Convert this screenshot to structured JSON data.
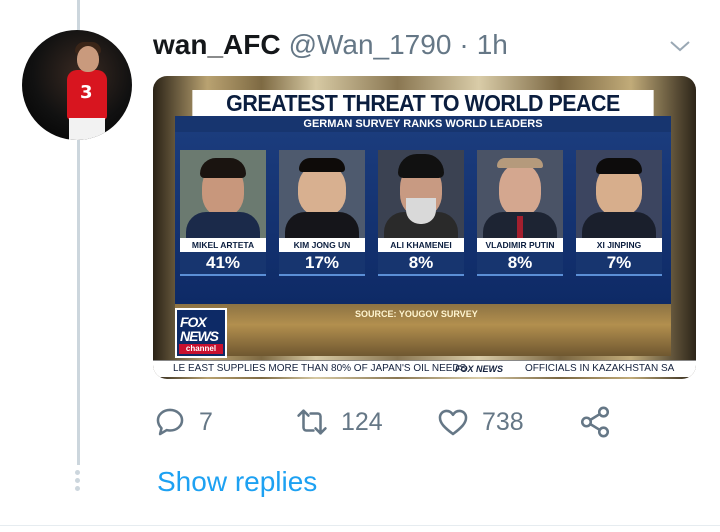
{
  "tweet": {
    "display_name": "wan_AFC",
    "handle": "@Wan_1790",
    "time_separator": "·",
    "time": "1h",
    "avatar_number": "3"
  },
  "media": {
    "headline": "GREATEST THREAT TO WORLD PEACE",
    "subheadline": "GERMAN SURVEY RANKS WORLD LEADERS",
    "leaders": [
      {
        "name": "MIKEL ARTETA",
        "pct": "41%"
      },
      {
        "name": "KIM JONG UN",
        "pct": "17%"
      },
      {
        "name": "ALI KHAMENEI",
        "pct": "8%"
      },
      {
        "name": "VLADIMIR PUTIN",
        "pct": "8%"
      },
      {
        "name": "XI JINPING",
        "pct": "7%"
      }
    ],
    "source": "SOURCE: YOUGOV SURVEY",
    "logo": {
      "line1": "FOX",
      "line2": "NEWS",
      "line3": "channel"
    },
    "ticker_left": "LE EAST SUPPLIES MORE THAN 80% OF JAPAN'S OIL NEEDS",
    "ticker_logo": "FOX NEWS",
    "ticker_right": "OFFICIALS IN KAZAKHSTAN SA"
  },
  "actions": {
    "replies": "7",
    "retweets": "124",
    "likes": "738"
  },
  "show_replies_label": "Show replies",
  "colors": {
    "twitter_blue": "#1da1f2",
    "muted_gray": "#657786",
    "fox_navy": "#17356f"
  }
}
